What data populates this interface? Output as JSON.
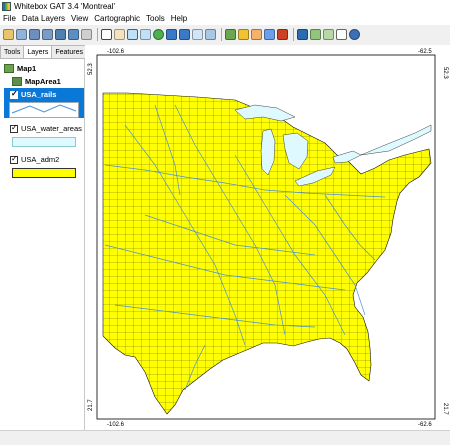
{
  "window": {
    "title": "Whitebox GAT 3.4 'Montreal'"
  },
  "menu": [
    "File",
    "Data Layers",
    "View",
    "Cartographic",
    "Tools",
    "Help"
  ],
  "tabs": [
    "Tools",
    "Layers",
    "Features"
  ],
  "active_tab": "Layers",
  "tree": {
    "map": "Map1",
    "map_area": "MapArea1",
    "layers": [
      {
        "name": "USA_rails",
        "checked": true,
        "selected": true,
        "symbol": "line"
      },
      {
        "name": "USA_water_areas",
        "checked": true,
        "selected": false,
        "symbol": "water-fill"
      },
      {
        "name": "USA_adm2",
        "checked": true,
        "selected": false,
        "symbol": "yellow-fill"
      }
    ]
  },
  "map": {
    "top_left_x": "-102.6",
    "top_right_x": "-62.5",
    "bottom_left_x": "-102.6",
    "bottom_right_x": "-62.6",
    "left_top_y": "52.3",
    "left_bottom_y": "21.7",
    "right_top_y": "52.3",
    "right_bottom_y": "21.7",
    "colors": {
      "land": "#ffff00",
      "water": "#def9ff",
      "border": "#111111",
      "rails": "#4a90d9"
    }
  },
  "toolbar_icons": [
    "open-icon",
    "save-icon",
    "layer-add-icon",
    "layer-remove-icon",
    "raster-icon",
    "vector-icon",
    "print-icon",
    "select-icon",
    "pan-icon",
    "zoom-in-icon",
    "zoom-out-icon",
    "globe-icon",
    "back-icon",
    "forward-icon",
    "zoom-extent-icon",
    "zoom-layer-icon",
    "book-icon",
    "folder-icon",
    "folder-open-icon",
    "save-map-icon",
    "export-icon",
    "table-icon",
    "script-icon",
    "ruler-icon",
    "profile-icon",
    "help-icon"
  ]
}
